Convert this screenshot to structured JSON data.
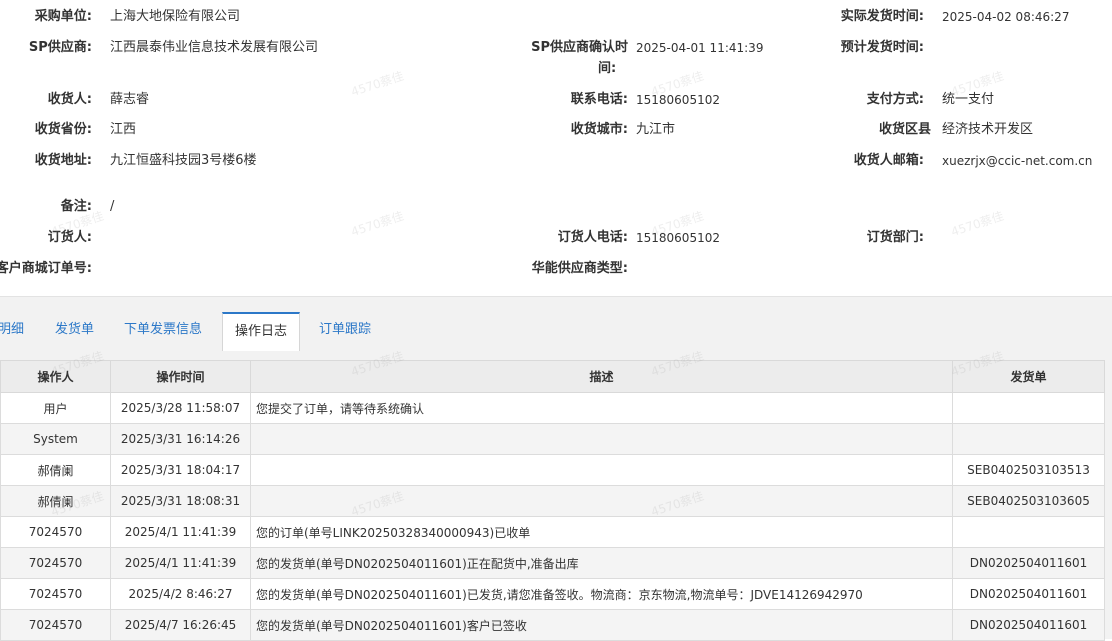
{
  "info": {
    "purchase_unit_label": "采购单位:",
    "purchase_unit_value": "上海大地保险有限公司",
    "actual_ship_time_label": "实际发货时间:",
    "actual_ship_time_value": "2025-04-02 08:46:27",
    "sp_supplier_label": "SP供应商:",
    "sp_supplier_value": "江西晨泰伟业信息技术发展有限公司",
    "sp_confirm_time_label_1": "SP供应商确认时",
    "sp_confirm_time_label_2": "间:",
    "sp_confirm_time_value": "2025-04-01 11:41:39",
    "planned_ship_time_label": "预计发货时间:",
    "planned_ship_time_value": "",
    "receiver_label": "收货人:",
    "receiver_value": "薛志睿",
    "contact_phone_label": "联系电话:",
    "contact_phone_value": "15180605102",
    "payment_label": "支付方式:",
    "payment_value": "统一支付",
    "province_label": "收货省份:",
    "province_value": "江西",
    "city_label": "收货城市:",
    "city_value": "九江市",
    "district_label": "收货区县",
    "district_value": "经济技术开发区",
    "address_label": "收货地址:",
    "address_value": "九江恒盛科技园3号楼6楼",
    "email_label": "收货人邮箱:",
    "email_value": "xuezrjx@ccic-net.com.cn",
    "remark_label": "备注:",
    "remark_value": "/",
    "orderer_label": "订货人:",
    "orderer_value": "",
    "orderer_phone_label": "订货人电话:",
    "orderer_phone_value": "15180605102",
    "order_dept_label": "订货部门:",
    "order_dept_value": "",
    "mall_order_label": "客户商城订单号:",
    "mall_order_value": "",
    "hn_supplier_type_label": "华能供应商类型:",
    "hn_supplier_type_value": ""
  },
  "tabs": [
    {
      "label": "明细"
    },
    {
      "label": "发货单"
    },
    {
      "label": "下单发票信息"
    },
    {
      "label": "操作日志",
      "active": true
    },
    {
      "label": "订单跟踪"
    }
  ],
  "log_table": {
    "headers": [
      "操作人",
      "操作时间",
      "描述",
      "发货单"
    ],
    "rows": [
      {
        "operator": "用户",
        "time": "2025/3/28 11:58:07",
        "desc": "您提交了订单，请等待系统确认",
        "shipment": ""
      },
      {
        "operator": "System",
        "time": "2025/3/31 16:14:26",
        "desc": "",
        "shipment": ""
      },
      {
        "operator": "郝倩阑",
        "time": "2025/3/31 18:04:17",
        "desc": "",
        "shipment": "SEB0402503103513"
      },
      {
        "operator": "郝倩阑",
        "time": "2025/3/31 18:08:31",
        "desc": "",
        "shipment": "SEB0402503103605"
      },
      {
        "operator": "7024570",
        "time": "2025/4/1 11:41:39",
        "desc": "您的订单(单号LINK20250328340000943)已收单",
        "shipment": ""
      },
      {
        "operator": "7024570",
        "time": "2025/4/1 11:41:39",
        "desc": "您的发货单(单号DN0202504011601)正在配货中,准备出库",
        "shipment": "DN0202504011601"
      },
      {
        "operator": "7024570",
        "time": "2025/4/2 8:46:27",
        "desc": "您的发货单(单号DN0202504011601)已发货,请您准备签收。物流商：京东物流,物流单号：JDVE14126942970",
        "shipment": "DN0202504011601"
      },
      {
        "operator": "7024570",
        "time": "2025/4/7 16:26:45",
        "desc": "您的发货单(单号DN0202504011601)客户已签收",
        "shipment": "DN0202504011601"
      }
    ]
  },
  "watermark": {
    "text": "4570蔡佳"
  }
}
